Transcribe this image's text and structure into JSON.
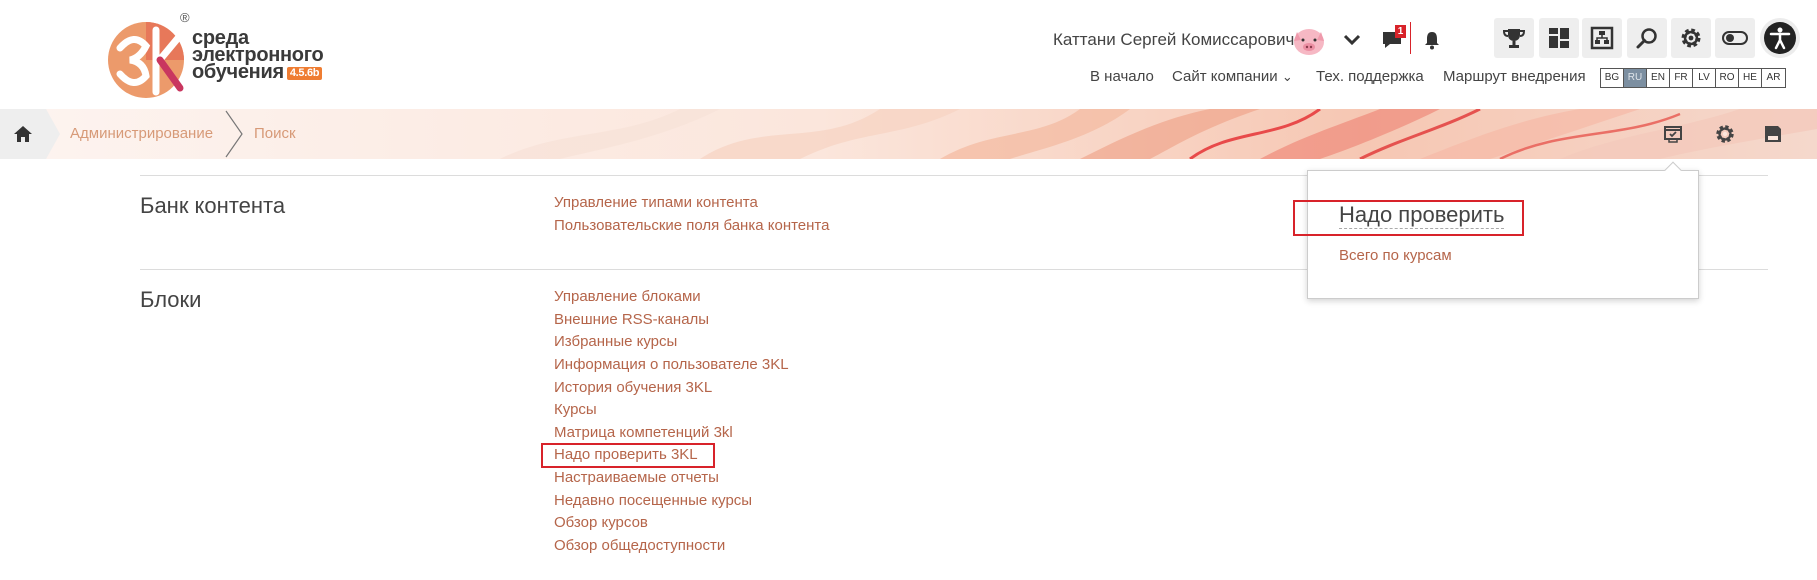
{
  "logo": {
    "reg_mark": "®",
    "line1": "среда",
    "line2": "электронного",
    "line3": "обучения",
    "version": "4.5.6b"
  },
  "header": {
    "user_name": "Каттани Сергей Комиссарович",
    "message_count": "1",
    "nav_links": [
      "В начало",
      "Сайт компании",
      "Тех. поддержка",
      "Маршрут внедрения"
    ],
    "dropdown_caret": "⌄",
    "languages": [
      "BG",
      "RU",
      "EN",
      "FR",
      "LV",
      "RO",
      "HE",
      "AR"
    ],
    "active_language": "RU"
  },
  "breadcrumb": {
    "items": [
      "Администрирование",
      "Поиск"
    ]
  },
  "sections": [
    {
      "title": "Банк контента",
      "links": [
        "Управление типами контента",
        "Пользовательские поля банка контента"
      ]
    },
    {
      "title": "Блоки",
      "links": [
        "Управление блоками",
        "Внешние RSS-каналы",
        "Избранные курсы",
        "Информация о пользователе 3KL",
        "История обучения 3KL",
        "Курсы",
        "Матрица компетенций 3kl",
        "Надо проверить 3KL",
        "Настраиваемые отчеты",
        "Недавно посещенные курсы",
        "Обзор курсов",
        "Обзор общедоступности"
      ]
    }
  ],
  "popover": {
    "title": "Надо проверить",
    "link": "Всего по курсам"
  },
  "colors": {
    "accent": "#ef7d32",
    "link": "#b5654a",
    "highlight": "#d8232a",
    "breadcrumb": "#d79a78"
  },
  "icons": [
    "chevron-down-icon",
    "chat-icon",
    "bell-icon",
    "trophy-icon",
    "dashboard-icon",
    "org-chart-icon",
    "search-icon",
    "gear-icon",
    "toggle-icon",
    "accessibility-icon",
    "home-icon",
    "review-icon",
    "save-icon"
  ]
}
